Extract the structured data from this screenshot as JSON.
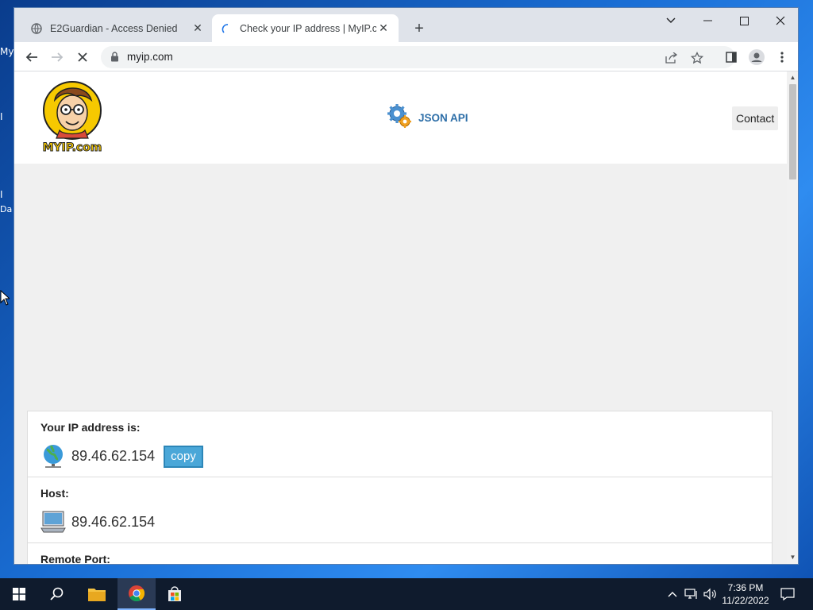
{
  "desktop": {
    "fragments": [
      "My",
      "I",
      "I",
      "Da"
    ]
  },
  "browser": {
    "tabs": [
      {
        "title": "E2Guardian - Access Denied",
        "icon": "globe-icon",
        "active": false
      },
      {
        "title": "Check your IP address | MyIP.com",
        "icon": "loading-spinner-icon",
        "active": true
      }
    ],
    "new_tab_label": "+",
    "url": "myip.com"
  },
  "site": {
    "logo_text": "MYIP.com",
    "nav": {
      "json_api": "JSON API",
      "contact": "Contact"
    },
    "info": {
      "ip_label": "Your IP address is:",
      "ip_value": "89.46.62.154",
      "copy_label": "copy",
      "host_label": "Host:",
      "host_value": "89.46.62.154",
      "port_label": "Remote Port:"
    }
  },
  "taskbar": {
    "time": "7:36 PM",
    "date": "11/22/2022"
  },
  "colors": {
    "accent": "#4aa7d8",
    "link": "#2e6fa8",
    "taskbar": "#0f1b2d"
  }
}
